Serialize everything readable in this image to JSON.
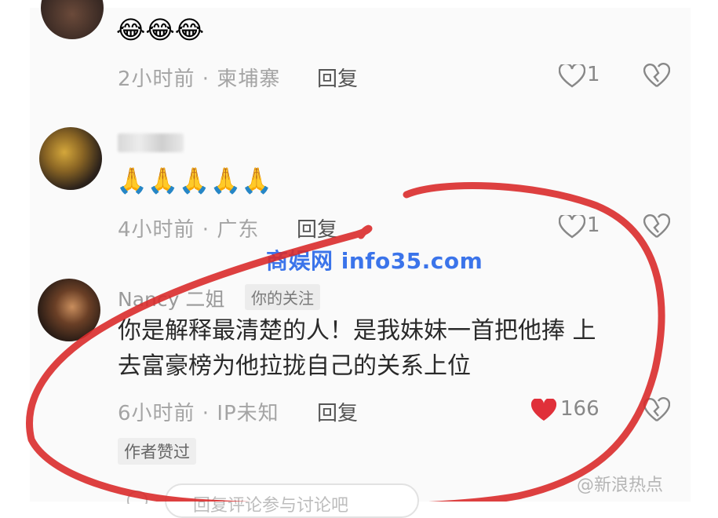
{
  "comments": [
    {
      "content_emoji": "😂😂😂",
      "time_location": "2小时前 · 柬埔寨",
      "reply_label": "回复",
      "like_count": "1",
      "liked": false
    },
    {
      "username": "██",
      "content_emoji": "🙏🙏🙏🙏🙏",
      "time_location": "4小时前 · 广东",
      "reply_label": "回复",
      "like_count": "1",
      "liked": false
    },
    {
      "username": "Nancy 二姐",
      "follow_tag": "你的关注",
      "content_line1": "你是解释最清楚的人！是我妹妹一首把他捧 上",
      "content_line2": "去富豪榜为他拉拢自己的关系上位",
      "time_location": "6小时前 · IP未知",
      "reply_label": "回复",
      "like_count": "166",
      "liked": true,
      "author_liked_tag": "作者赞过"
    }
  ],
  "reply_input": {
    "placeholder": "回复评论参与讨论吧"
  },
  "watermark_text": "商娱网 info35.com",
  "weibo_watermark": "@新浪热点",
  "colors": {
    "annotation_red": "#d92b2b",
    "heart_red": "#e0303a",
    "watermark_blue": "#3b74ea"
  }
}
